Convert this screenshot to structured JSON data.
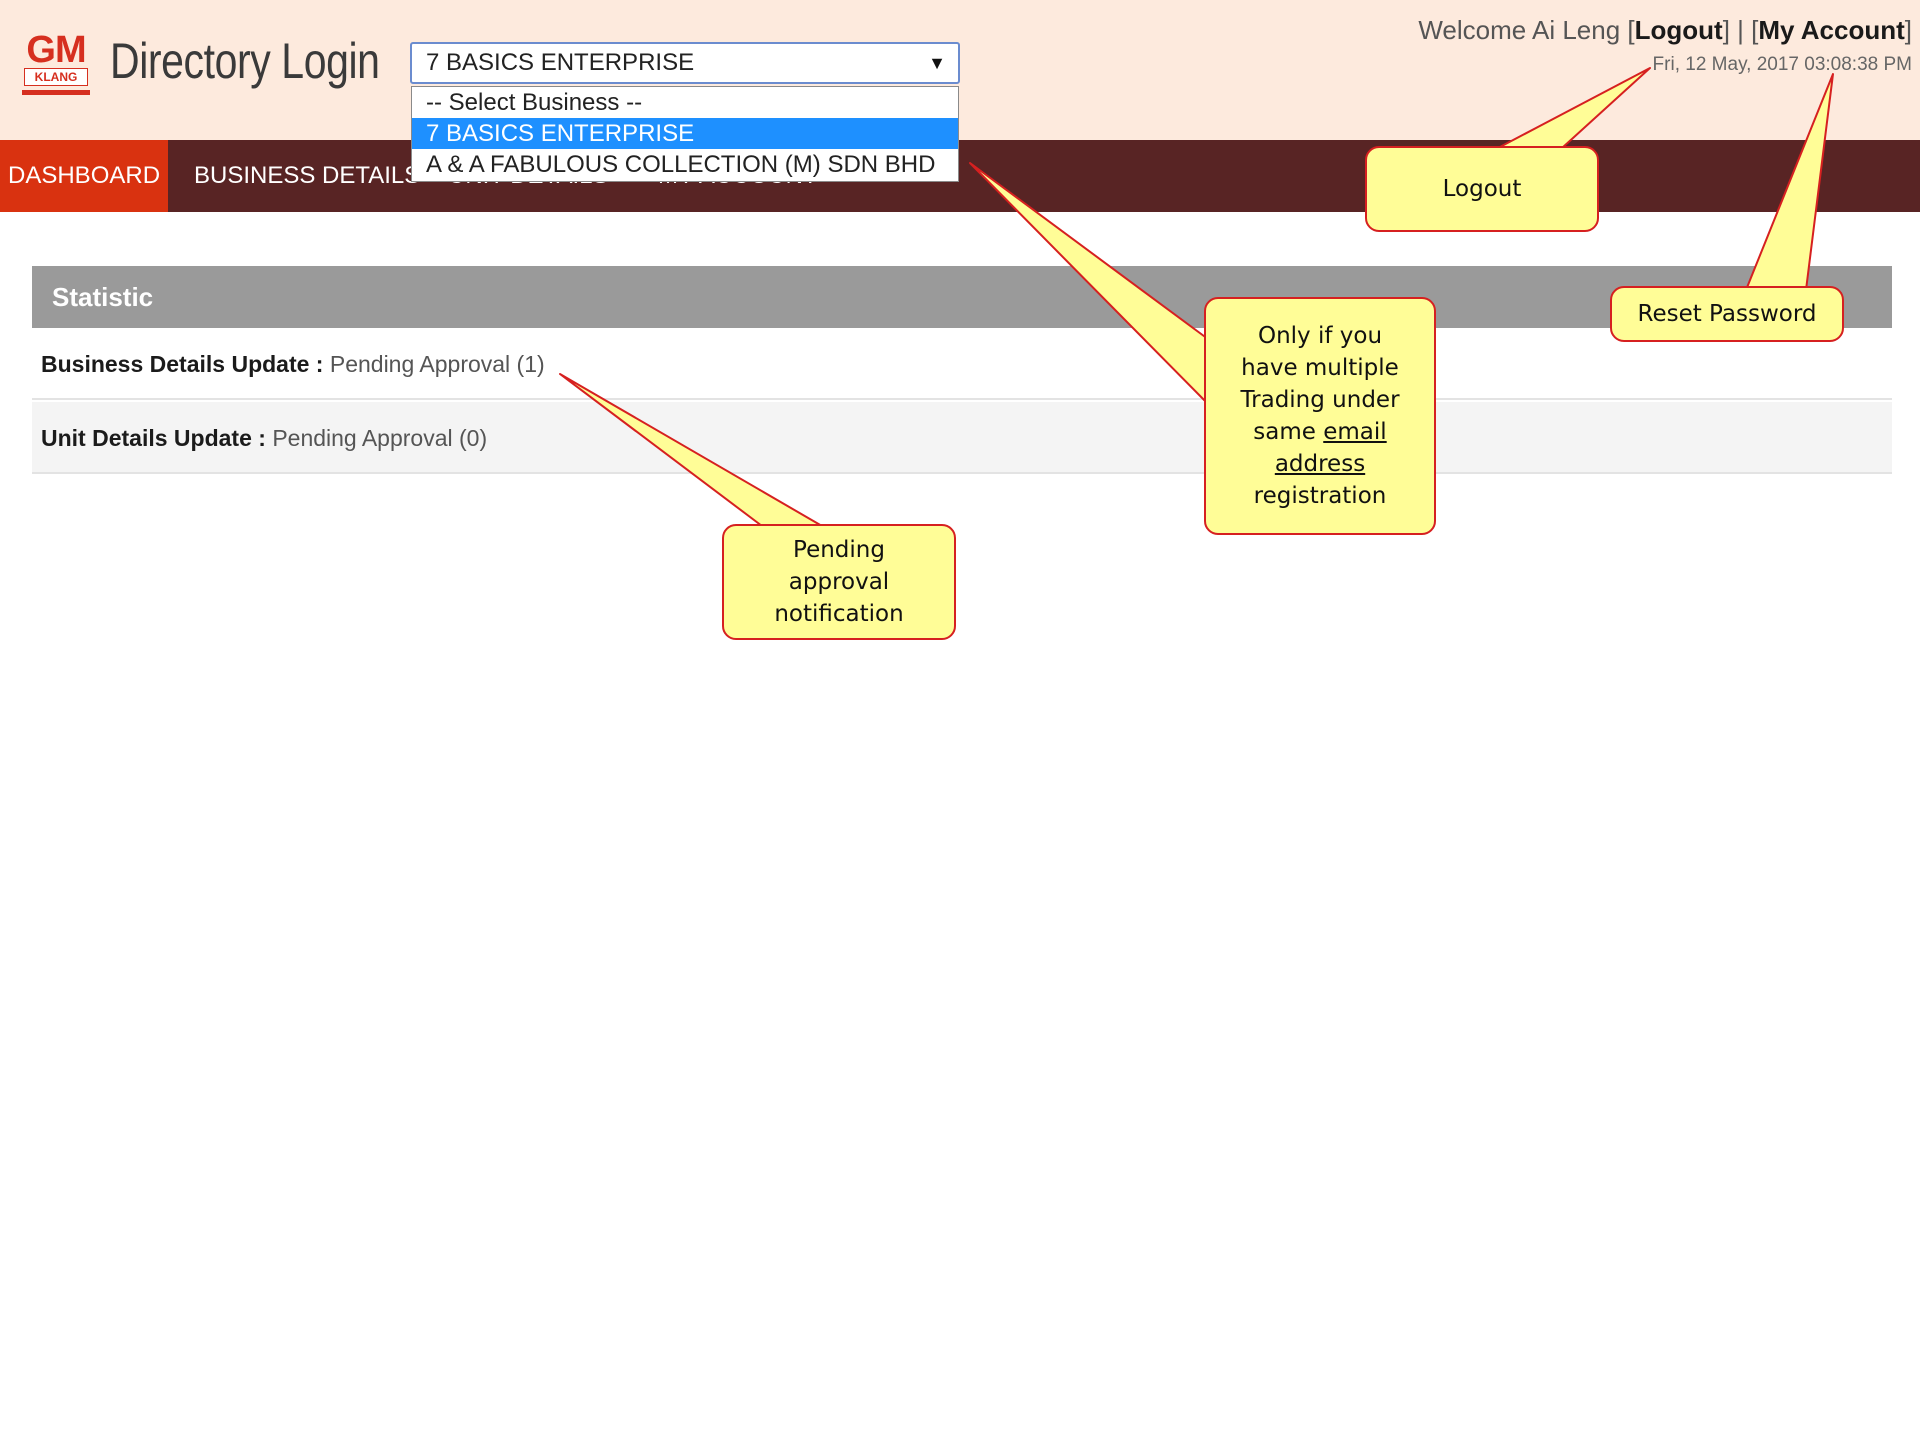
{
  "header": {
    "logo": {
      "top": "GM",
      "bottom": "KLANG"
    },
    "title": "Directory Login",
    "business_select": {
      "value": "7 BASICS ENTERPRISE",
      "options": [
        "-- Select Business --",
        "7 BASICS ENTERPRISE",
        "A & A FABULOUS COLLECTION (M) SDN BHD"
      ]
    },
    "welcome_prefix": "Welcome Ai Leng [",
    "logout": "Logout",
    "mid_sep": "] | [",
    "my_account": "My Account",
    "suffix": "]",
    "datetime": "Fri, 12 May, 2017 03:08:38 PM"
  },
  "nav": {
    "items": [
      "DASHBOARD",
      "BUSINESS DETAILS",
      "UNIT DETAILS",
      "MY ACCOUNT"
    ]
  },
  "statistic": {
    "title": "Statistic",
    "rows": [
      {
        "label": "Business Details Update :",
        "value": "Pending Approval (1)"
      },
      {
        "label": "Unit Details Update :",
        "value": "Pending Approval (0)"
      }
    ]
  },
  "callouts": {
    "logout": "Logout",
    "reset_password": "Reset Password",
    "multiple_trading": {
      "line1": "Only if you",
      "line2": "have multiple",
      "line3": "Trading under",
      "line4_pre": "same ",
      "line4_ul": "email",
      "line5": "address",
      "line6": "registration"
    },
    "pending": {
      "line1": "Pending",
      "line2": "approval",
      "line3": "notification"
    }
  },
  "colors": {
    "header_bg": "#fdeadd",
    "nav_bg": "#582424",
    "nav_active": "#d93210",
    "panel_head": "#9a9a9a",
    "callout_fill": "#fffd97",
    "callout_border": "#d62020",
    "select_highlight": "#1e90ff"
  }
}
